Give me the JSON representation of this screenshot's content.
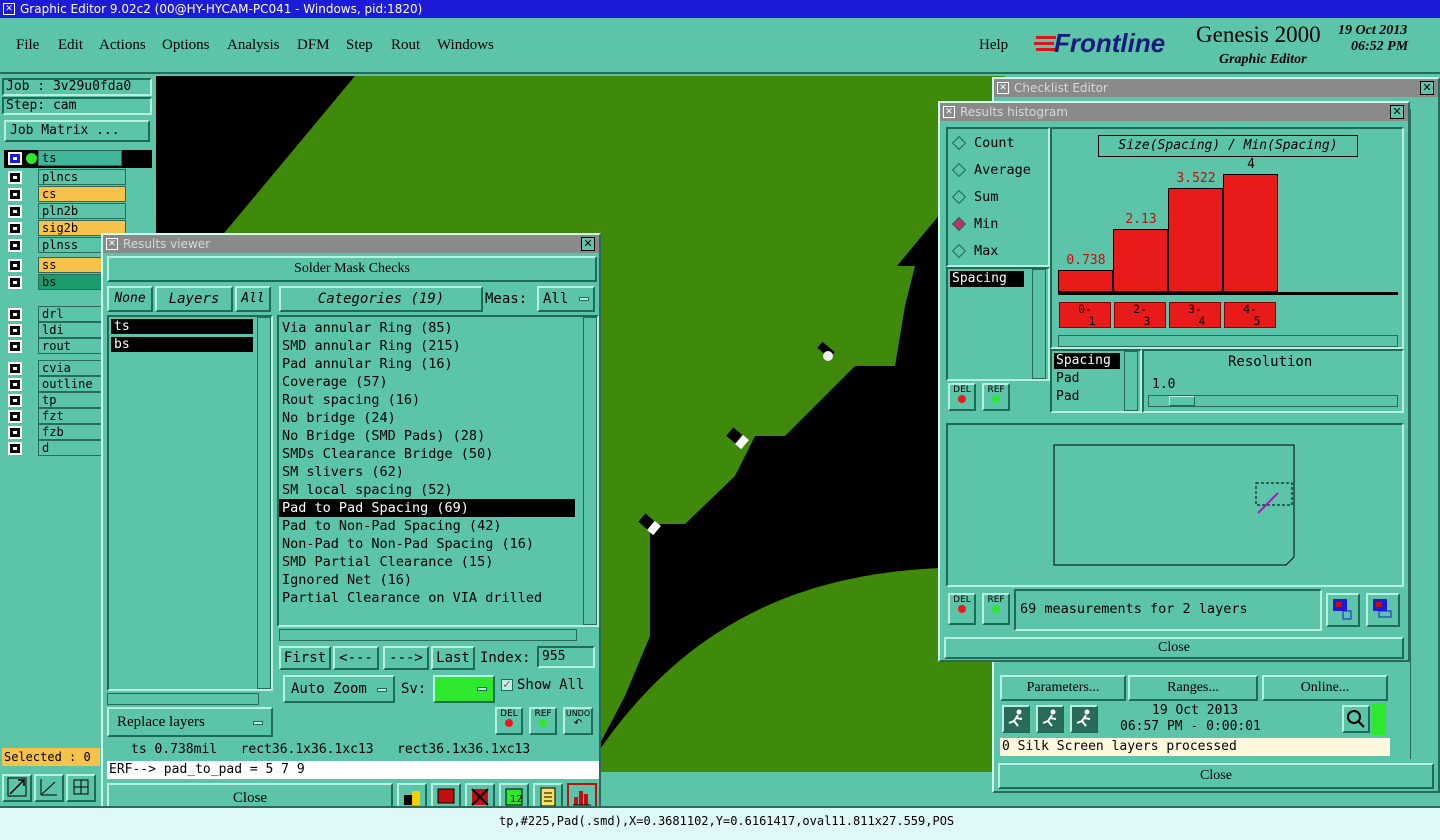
{
  "app": {
    "title": "Graphic Editor 9.02c2 (00@HY-HYCAM-PC041 - Windows, pid:1820)"
  },
  "menu": {
    "file": "File",
    "edit": "Edit",
    "actions": "Actions",
    "options": "Options",
    "analysis": "Analysis",
    "dfm": "DFM",
    "step": "Step",
    "rout": "Rout",
    "windows": "Windows",
    "help": "Help"
  },
  "brand": {
    "logo": "Frontline",
    "product": "Genesis 2000",
    "subtitle": "Graphic Editor",
    "date": "19 Oct 2013",
    "time": "06:52 PM"
  },
  "left": {
    "job": "Job : 3v29u0fda0",
    "step": "Step: cam",
    "job_matrix": "Job Matrix ...",
    "selected": "Selected : 0",
    "layers": [
      "ts",
      "plncs",
      "cs",
      "pln2b",
      "sig2b",
      "plnss",
      "ss",
      "bs",
      "drl",
      "ldi",
      "rout",
      "cvia",
      "outline",
      "tp",
      "fzt",
      "fzb",
      "d"
    ]
  },
  "results_viewer": {
    "title": "Results viewer",
    "heading": "Solder Mask Checks",
    "none": "None",
    "layers": "Layers",
    "all": "All",
    "categories_label": "Categories (19)",
    "meas_label": "Meas:",
    "meas_value": "All",
    "layer_list": [
      "ts",
      "bs"
    ],
    "categories": [
      "Via annular Ring (85)",
      "SMD annular Ring (215)",
      "Pad annular Ring (16)",
      "Coverage (57)",
      "Rout spacing (16)",
      "No bridge (24)",
      "No Bridge (SMD Pads) (28)",
      "SMDs Clearance Bridge (50)",
      "SM slivers (62)",
      "SM local spacing (52)",
      "Pad to Pad Spacing (69)",
      "Pad to Non-Pad Spacing (42)",
      "Non-Pad to Non-Pad Spacing (16)",
      "SMD Partial Clearance (15)",
      "Ignored Net (16)",
      "Partial Clearance on VIA drilled"
    ],
    "first": "First",
    "prev": "<---",
    "next": "--->",
    "last": "Last",
    "index_label": "Index:",
    "index_value": "955",
    "auto_zoom": "Auto Zoom",
    "sv": "Sv:",
    "show_all": "Show All",
    "replace_layers": "Replace layers",
    "del": "DEL",
    "ref": "REF",
    "undo": "UNDO",
    "status": "ts 0.738mil   rect36.1x36.1xc13   rect36.1x36.1xc13",
    "erf": "ERF--> pad_to_pad = 5 7 9",
    "close": "Close"
  },
  "histogram": {
    "title": "Results histogram",
    "options": [
      "Count",
      "Average",
      "Sum",
      "Min",
      "Max"
    ],
    "selected": "Min",
    "chart_title": "Size(Spacing) / Min(Spacing)",
    "list_item": "Spacing",
    "list2": [
      "Spacing",
      "Pad",
      "Pad"
    ],
    "resolution_label": "Resolution",
    "resolution_value": "1.0",
    "measurements": "69 measurements for 2 layers",
    "del": "DEL",
    "ref": "REF",
    "close": "Close"
  },
  "chart_data": {
    "type": "bar",
    "title": "Size(Spacing) / Min(Spacing)",
    "categories": [
      "0-1",
      "2-3",
      "3-4",
      "4-5"
    ],
    "values": [
      0.738,
      2.13,
      3.522,
      4
    ],
    "value_labels": [
      "0.738",
      "2.13",
      "3.522",
      "4"
    ]
  },
  "checklist": {
    "title": "Checklist Editor",
    "parameters": "Parameters...",
    "ranges": "Ranges...",
    "online": "Online...",
    "date": "19 Oct 2013",
    "time": "06:57 PM - 0:00:01",
    "status": "0 Silk Screen layers processed",
    "close": "Close"
  },
  "statusbar": {
    "text": "tp,#225,Pad(.smd),X=0.3681102,Y=0.6161417,oval11.811x27.559,POS"
  },
  "colors": {
    "title_bar": "#1b1bd8",
    "panel": "#5cc4a9",
    "board": "#3f8a0b",
    "bar": "#e81a1a",
    "highlight": "#f7c24a"
  }
}
